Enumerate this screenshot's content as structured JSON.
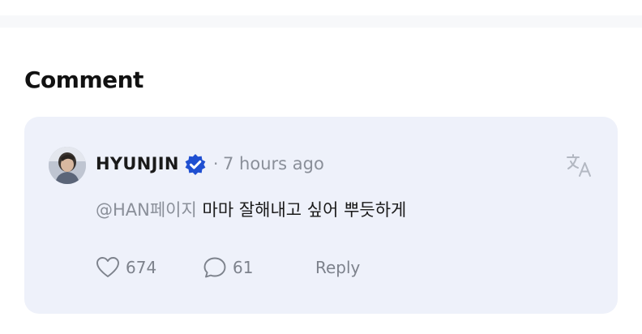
{
  "section": {
    "title": "Comment"
  },
  "comment": {
    "author": "HYUNJIN",
    "time": "7 hours ago",
    "mention": "@HAN페이지",
    "text": "마마 잘해내고 싶어 뿌듯하게",
    "likes": "674",
    "replies": "61",
    "reply_label": "Reply"
  },
  "icons": {
    "verified": "verified-badge-icon",
    "translate": "translate-icon",
    "like": "heart-icon",
    "comments": "speech-bubble-icon"
  },
  "colors": {
    "card_bg": "#eef1fa",
    "verified": "#1f4fd1",
    "muted": "#8a8f99"
  }
}
